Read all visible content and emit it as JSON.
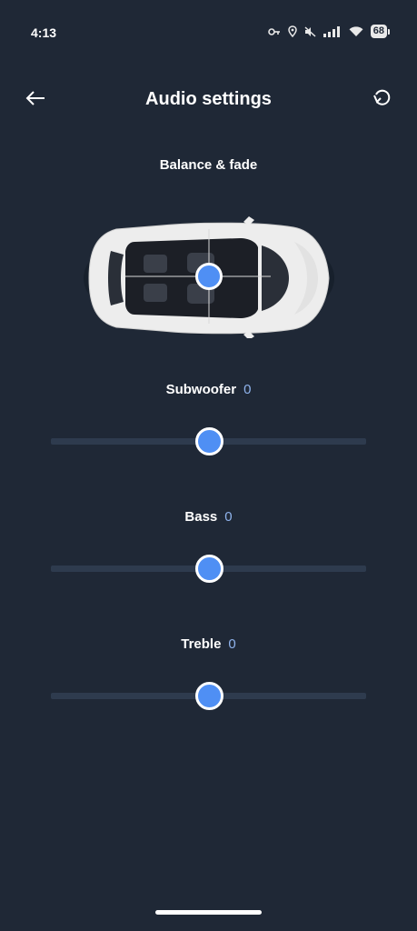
{
  "status_bar": {
    "time": "4:13",
    "battery": "68",
    "icons": [
      "key-icon",
      "location-icon",
      "mute-icon",
      "signal-icon",
      "wifi-icon",
      "battery-icon"
    ]
  },
  "header": {
    "title": "Audio settings",
    "back_icon": "arrow-left-icon",
    "reset_icon": "reset-icon"
  },
  "balance": {
    "label": "Balance & fade",
    "balance_value": 0,
    "fade_value": 0
  },
  "sliders": [
    {
      "label": "Subwoofer",
      "value": "0",
      "position_fraction": 0.5
    },
    {
      "label": "Bass",
      "value": "0",
      "position_fraction": 0.5
    },
    {
      "label": "Treble",
      "value": "0",
      "position_fraction": 0.5
    }
  ],
  "colors": {
    "background": "#1f2836",
    "accent": "#4f8ff4",
    "value_text": "#8fb3ec",
    "track": "#2e3b4e"
  }
}
